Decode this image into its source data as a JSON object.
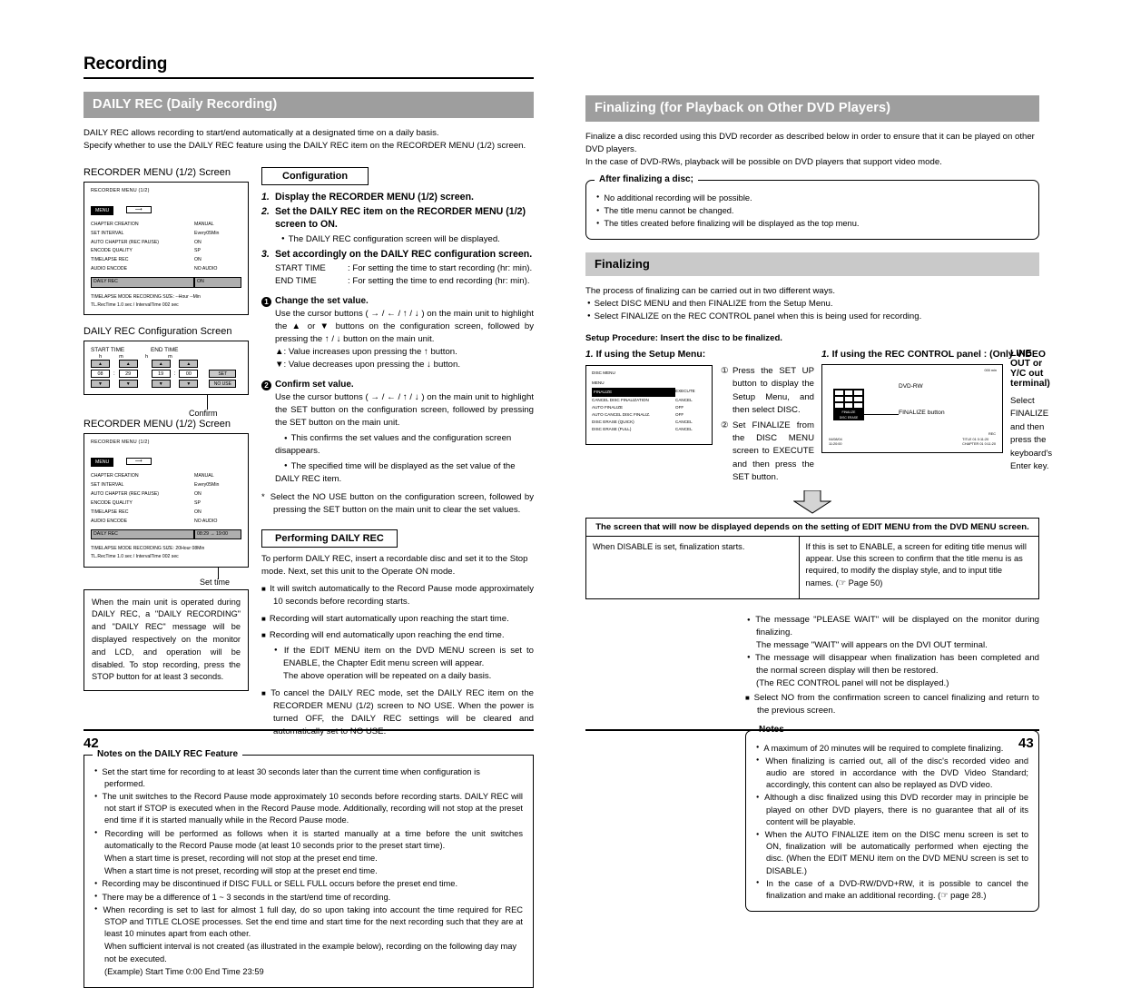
{
  "document": {
    "chapter_title": "Recording",
    "page_left": "42",
    "page_right": "43"
  },
  "left_page": {
    "section_band": "DAILY REC (Daily Recording)",
    "intro_line1": "DAILY REC allows recording to start/end automatically at a designated time on a daily basis.",
    "intro_line2": "Specify whether to use the DAILY REC feature using the DAILY REC item on the RECORDER MENU (1/2) screen.",
    "screens": {
      "caption_menu_1": "RECORDER MENU (1/2) Screen",
      "caption_config": "DAILY REC Configuration Screen",
      "caption_menu_2": "RECORDER MENU (1/2) Screen",
      "recorder_menu": {
        "title": "RECORDER MENU (1/2)",
        "menu_chip": "MENU",
        "rows": [
          {
            "label": "CHAPTER CREATION",
            "value": "MANUAL"
          },
          {
            "label": "SET INTERVAL",
            "value": "Every05Min"
          },
          {
            "label": "AUTO CHAPTER (REC PAUSE)",
            "value": "ON"
          },
          {
            "label": "ENCODE QUALITY",
            "value": "SP"
          },
          {
            "label": "TIMELAPSE REC",
            "value": "ON"
          },
          {
            "label": "AUDIO ENCODE",
            "value": "NO AUDIO"
          }
        ],
        "highlight_label": "DAILY REC",
        "highlight_value_1": "ON",
        "highlight_value_2": "08:29  →  19:00",
        "footer_1": "TIMELAPSE MODE RECORDING SIZE: --Hour --Min",
        "footer_2": "TL.RecTime    1.0 sec / IntervalTime  002 sec",
        "footer_1b": "TIMELAPSE MODE RECORDING SIZE: 20Hour 08Min",
        "footer_2b": "TL.RecTime    1.0 sec / IntervalTime  002 sec"
      },
      "config_screen": {
        "start_title": "START TIME",
        "end_title": "END TIME",
        "h": "h",
        "m": "m",
        "up_glyph": "▲",
        "down_glyph": "▼",
        "start_hour": "08",
        "start_min": "29",
        "end_hour": "19",
        "end_min": "00",
        "set_button": "SET",
        "nouse_button": "NO USE",
        "confirm_label": "Confirm"
      },
      "set_time_label": "Set time"
    },
    "configuration": {
      "box_title": "Configuration",
      "steps": [
        {
          "num": "1.",
          "text": "Display the RECORDER MENU (1/2) screen."
        },
        {
          "num": "2.",
          "text": "Set the DAILY REC item on the RECORDER MENU (1/2) screen to ON."
        },
        {
          "num": "3.",
          "text": "Set accordingly on the DAILY REC configuration screen."
        }
      ],
      "step2_bullet": "The DAILY REC configuration screen will be displayed.",
      "step3_kv": [
        {
          "k": "START TIME",
          "v": ": For setting the time to start recording (hr: min)."
        },
        {
          "k": "END TIME",
          "v": ": For setting the time to end recording (hr: min)."
        }
      ],
      "item1_title": "Change the set value.",
      "item1_body": "Use the cursor buttons ( → / ← / ↑ / ↓ ) on the main unit to highlight the ▲ or ▼ buttons on the configuration screen, followed by pressing the ↑ / ↓ button on the main unit.",
      "item1_line_up": "▲: Value increases upon pressing the ↑ button.",
      "item1_line_down": "▼: Value decreases upon pressing the ↓ button.",
      "item2_title": "Confirm set value.",
      "item2_body": "Use the cursor buttons ( → / ← / ↑ / ↓ ) on the main unit to highlight the SET button on the configuration screen, followed by pressing the SET button on the main unit.",
      "item2_bullets": [
        "This confirms the set values and the configuration screen disappears.",
        "The specified time will be displayed as the set value of the DAILY REC item."
      ],
      "star_note": "Select the NO USE button on the configuration screen, followed by pressing the SET button on the main unit to clear the set values."
    },
    "performing": {
      "box_title": "Performing DAILY REC",
      "intro": "To perform DAILY REC, insert a recordable disc and set it to the Stop mode. Next, set this unit to the Operate ON mode.",
      "items": [
        "It will switch automatically to the Record Pause mode approximately 10 seconds before recording starts.",
        "Recording will start automatically upon reaching the start time.",
        "Recording will end automatically upon reaching the end time."
      ],
      "sub_bullet": "If the EDIT MENU item on the DVD MENU screen is set to ENABLE, the Chapter Edit menu screen will appear.",
      "sub_bullet_cont": "The above operation will be repeated on a daily basis.",
      "last_item": "To cancel the DAILY REC mode, set the DAILY REC item on the RECORDER MENU (1/2) screen to NO USE. When the power is turned OFF, the DAILY REC settings will be cleared and automatically set to NO USE."
    },
    "operation_box": "When the main unit is operated during DAILY REC, a \"DAILY RECORDING\" and \"DAILY REC\" message will be displayed respectively on the monitor and LCD, and operation will be disabled. To stop recording, press the STOP button for at least 3 seconds.",
    "notes": {
      "legend": "Notes on the DAILY REC Feature",
      "items": [
        "Set the start time for recording to at least 30 seconds later than the current time when configuration is performed.",
        "The unit switches to the Record Pause mode approximately 10 seconds before recording starts. DAILY REC will not start if STOP is executed when in the Record Pause mode. Additionally, recording will not stop at the preset end time if it is started manually while in the Record Pause mode.",
        "Recording will be performed as follows when it is started manually at a time before the unit switches automatically to the Record Pause mode (at least 10 seconds prior to the preset start time).",
        "Recording may be discontinued if DISC FULL or SELL FULL occurs before the preset end time.",
        "There may be a difference of 1 ~ 3 seconds in the start/end time of recording.",
        "When recording is set to last for almost 1 full day, do so upon taking into account the time required for REC STOP and TITLE CLOSE processes. Set the end time and start time for the next recording such that they are at least 10 minutes apart from each other."
      ],
      "cont_after_3a": "When a start time is preset, recording will not stop at the preset end time.",
      "cont_after_3b": "When a start time is not preset, recording will stop at the preset end time.",
      "cont_after_6a": "When sufficient interval is not created (as illustrated in the example below), recording on the following day may not be executed.",
      "cont_after_6b": "(Example) Start Time 0:00                        End Time 23:59"
    }
  },
  "right_page": {
    "section_band": "Finalizing (for Playback on Other DVD Players)",
    "intro_line1": "Finalize a disc recorded using this DVD recorder as described below in order to ensure that it can be played on other DVD players.",
    "intro_line2": "In the case of DVD-RWs, playback will be possible on DVD players that support video mode.",
    "after_box": {
      "legend": "After finalizing a disc;",
      "items": [
        "No additional recording will be possible.",
        "The title menu cannot be changed.",
        "The titles created before finalizing will be displayed as the top menu."
      ]
    },
    "finalizing_band": "Finalizing",
    "process_intro": "The process of finalizing can be carried out in two different ways.",
    "process_bullets": [
      "Select DISC MENU and then FINALIZE from the Setup Menu.",
      "Select FINALIZE on the REC CONTROL panel when this is being used for recording."
    ],
    "setup_procedure": "Setup Procedure: Insert the disc to be finalized.",
    "method_a": {
      "heading_num": "1.",
      "heading": "If using the Setup Menu:",
      "steps": [
        {
          "c": "①",
          "t": "Press the SET UP button to display the Setup Menu, and then select DISC."
        },
        {
          "c": "②",
          "t": "Set FINALIZE from the DISC MENU screen to EXECUTE and then press the SET button."
        }
      ],
      "disc_menu": {
        "title": "DISC MENU",
        "menu": "MENU",
        "rows": [
          {
            "label": "FINALIZE",
            "value": "EXECUTE",
            "selected": true
          },
          {
            "label": "CANCEL DISC FINALIZATION",
            "value": "CANCEL",
            "selected": false
          },
          {
            "label": "AUTO FINALIZE",
            "value": "OFF",
            "selected": false
          },
          {
            "label": "AUTO CANCEL DISC FINALIZ.",
            "value": "OFF",
            "selected": false
          },
          {
            "label": "DISC ERASE (QUICK)",
            "value": "CANCEL",
            "selected": false
          },
          {
            "label": "DISC ERASE (FULL)",
            "value": "CANCEL",
            "selected": false
          }
        ]
      }
    },
    "method_b": {
      "heading_num": "1.",
      "heading_line1": "If using the REC CONTROL panel  :  (Only VIDEO",
      "heading_line2": "LINE OUT or Y/C out terminal)",
      "body": "Select FINALIZE and then press the keyboard's Enter key.",
      "rec_panel": {
        "top_right": "000 min",
        "disc_type": "DVD-RW",
        "finalize_label": "FINALIZE button",
        "button_1": "FINALIZE",
        "button_2": "DISC ERASE",
        "rec_badge": "REC",
        "date": "04/08/04",
        "time": "11:20:00",
        "title_line": "TITLE 01  0:11:20",
        "chapter_line": "CHAPTER 01  0:11:20"
      }
    },
    "result_table": {
      "header": "The screen that will now be displayed depends on the setting of EDIT MENU from the DVD MENU screen.",
      "left_cell": "When DISABLE is set, finalization starts.",
      "right_cell": "If this is set to ENABLE, a screen for editing title menus will appear. Use this screen to confirm that the title menu is as required, to modify the display style, and to input title names. (☞ Page 50)"
    },
    "post_bullets": [
      "The message \"PLEASE WAIT\" will be displayed on the monitor during finalizing.",
      "The message \"WAIT\" will appears on the DVI OUT terminal.",
      "The message will disappear when finalization has been completed and the normal screen display will then be restored.",
      "(The REC CONTROL panel will not be displayed.)"
    ],
    "post_square": "Select NO from the confirmation screen to cancel finalizing and return to the previous screen.",
    "notes": {
      "legend": "Notes",
      "items": [
        "A maximum of 20 minutes will be required to complete finalizing.",
        "When finalizing is carried out, all of the disc's recorded video and audio are stored in accordance with the DVD Video Standard; accordingly, this content can also be replayed as DVD video.",
        "Although a disc finalized using this DVD recorder may in principle be played on other DVD players, there is no guarantee that all of its content will be playable.",
        "When the AUTO FINALIZE item on the DISC menu screen is set to ON, finalization will be automatically performed when ejecting the disc.  (When the EDIT MENU item on the DVD MENU screen is set to DISABLE.)",
        "In the case of a DVD-RW/DVD+RW, it is possible to cancel the finalization and make an additional recording.  (☞ page 28.)"
      ]
    }
  }
}
